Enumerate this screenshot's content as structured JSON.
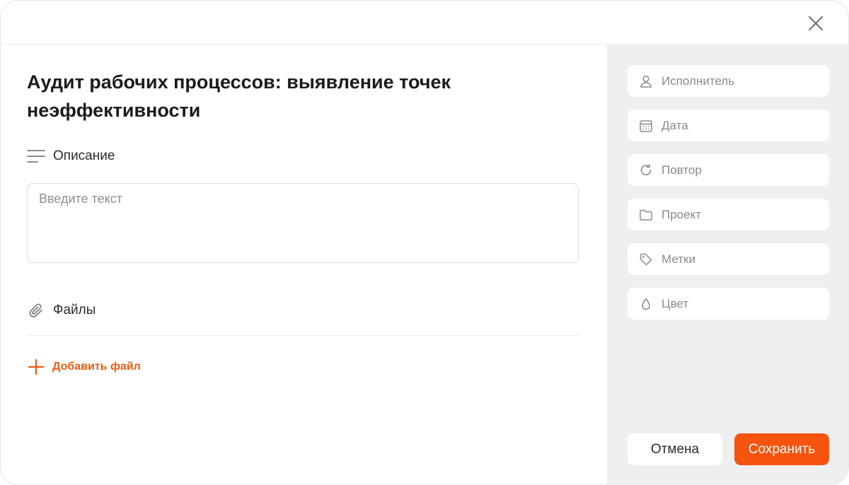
{
  "task": {
    "title": "Аудит рабочих процессов: выявление точек неэффективности"
  },
  "description": {
    "label": "Описание",
    "placeholder": "Введите текст",
    "value": ""
  },
  "files": {
    "label": "Файлы",
    "add_label": "Добавить файл"
  },
  "sidebar": {
    "fields": [
      {
        "label": "Исполнитель",
        "icon": "user-icon"
      },
      {
        "label": "Дата",
        "icon": "calendar-icon"
      },
      {
        "label": "Повтор",
        "icon": "repeat-icon"
      },
      {
        "label": "Проект",
        "icon": "folder-icon"
      },
      {
        "label": "Метки",
        "icon": "tag-icon"
      },
      {
        "label": "Цвет",
        "icon": "droplet-icon"
      }
    ]
  },
  "actions": {
    "cancel_label": "Отмена",
    "save_label": "Сохранить"
  },
  "colors": {
    "accent": "#f5530e",
    "sidebar_bg": "#efeff0",
    "muted_text": "#8a8a8f"
  }
}
